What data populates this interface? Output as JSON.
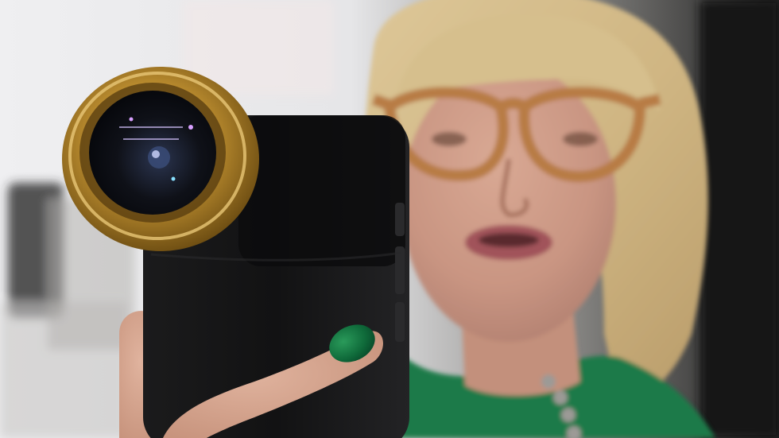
{
  "photo": {
    "subject": "woman",
    "held_object": "smartphone",
    "accessory": "lens attachment",
    "lens_ring_text": "",
    "colors": {
      "background_left": "#e9e8ea",
      "background_right": "#242424",
      "phone_body": "#141414",
      "lens_gold": "#b88a2e",
      "lens_glass": "#111318",
      "skin": "#cfa08a",
      "hair": "#d8c28e",
      "glasses_frame": "#b87b44",
      "nail_polish": "#0f6a3a",
      "sweater": "#1c7a49"
    }
  }
}
